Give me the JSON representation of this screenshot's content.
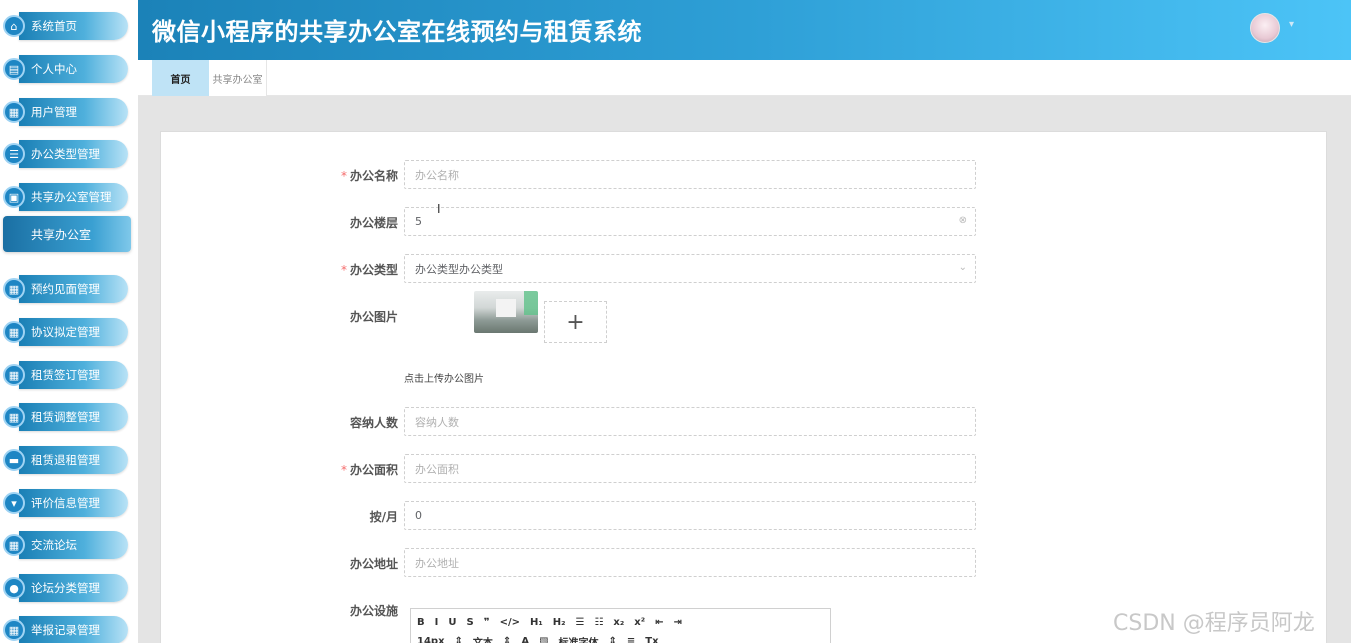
{
  "app": {
    "title": "微信小程序的共享办公室在线预约与租赁系统",
    "avatar_caret": "▾"
  },
  "sidebar": {
    "items": [
      {
        "label": "系统首页",
        "icon": "⌂",
        "icon_name": "home-icon"
      },
      {
        "label": "个人中心",
        "icon": "▤",
        "icon_name": "profile-icon"
      },
      {
        "label": "用户管理",
        "icon": "▦",
        "icon_name": "grid-icon"
      },
      {
        "label": "办公类型管理",
        "icon": "☰",
        "icon_name": "list-icon"
      },
      {
        "label": "共享办公室管理",
        "icon": "▣",
        "icon_name": "building-icon"
      },
      {
        "label": "预约见面管理",
        "icon": "▦",
        "icon_name": "grid-icon"
      },
      {
        "label": "协议拟定管理",
        "icon": "▦",
        "icon_name": "grid-icon"
      },
      {
        "label": "租赁签订管理",
        "icon": "▦",
        "icon_name": "table-icon"
      },
      {
        "label": "租赁调整管理",
        "icon": "▦",
        "icon_name": "grid-icon"
      },
      {
        "label": "租赁退租管理",
        "icon": "▬",
        "icon_name": "monitor-icon"
      },
      {
        "label": "评价信息管理",
        "icon": "▾",
        "icon_name": "comment-icon"
      },
      {
        "label": "交流论坛",
        "icon": "▦",
        "icon_name": "grid-icon"
      },
      {
        "label": "论坛分类管理",
        "icon": "●",
        "icon_name": "user-icon"
      },
      {
        "label": "举报记录管理",
        "icon": "▦",
        "icon_name": "grid-icon"
      }
    ],
    "active_sub": "共享办公室"
  },
  "tabs": [
    {
      "label": "首页",
      "active": true
    },
    {
      "label": "共享办公室",
      "active": false
    }
  ],
  "form": {
    "name": {
      "label": "办公名称",
      "placeholder": "办公名称",
      "required": true
    },
    "floor": {
      "label": "办公楼层",
      "value": "5",
      "suffix": "⊗"
    },
    "type": {
      "label": "办公类型",
      "value": "办公类型办公类型",
      "required": true,
      "suffix": "⌄"
    },
    "image": {
      "label": "办公图片",
      "upload_symbol": "+",
      "hint": "点击上传办公图片"
    },
    "capacity": {
      "label": "容纳人数",
      "placeholder": "容纳人数"
    },
    "area": {
      "label": "办公面积",
      "placeholder": "办公面积",
      "required": true
    },
    "monthly": {
      "label": "按/月",
      "value": "0"
    },
    "address": {
      "label": "办公地址",
      "placeholder": "办公地址"
    },
    "facilities": {
      "label": "办公设施"
    }
  },
  "editor": {
    "row1": [
      "B",
      "I",
      "U",
      "S",
      "❞",
      "</>",
      "H₁",
      "H₂",
      "☰",
      "☷",
      "x₂",
      "x²",
      "⇤",
      "⇥"
    ],
    "row2": [
      "14px",
      "⇕",
      "文本",
      "⇕",
      "A",
      "▧",
      "标准字体",
      "⇕",
      "≡",
      "Tx"
    ]
  },
  "watermark": "CSDN @程序员阿龙",
  "cursor": "I",
  "required_mark": "*"
}
